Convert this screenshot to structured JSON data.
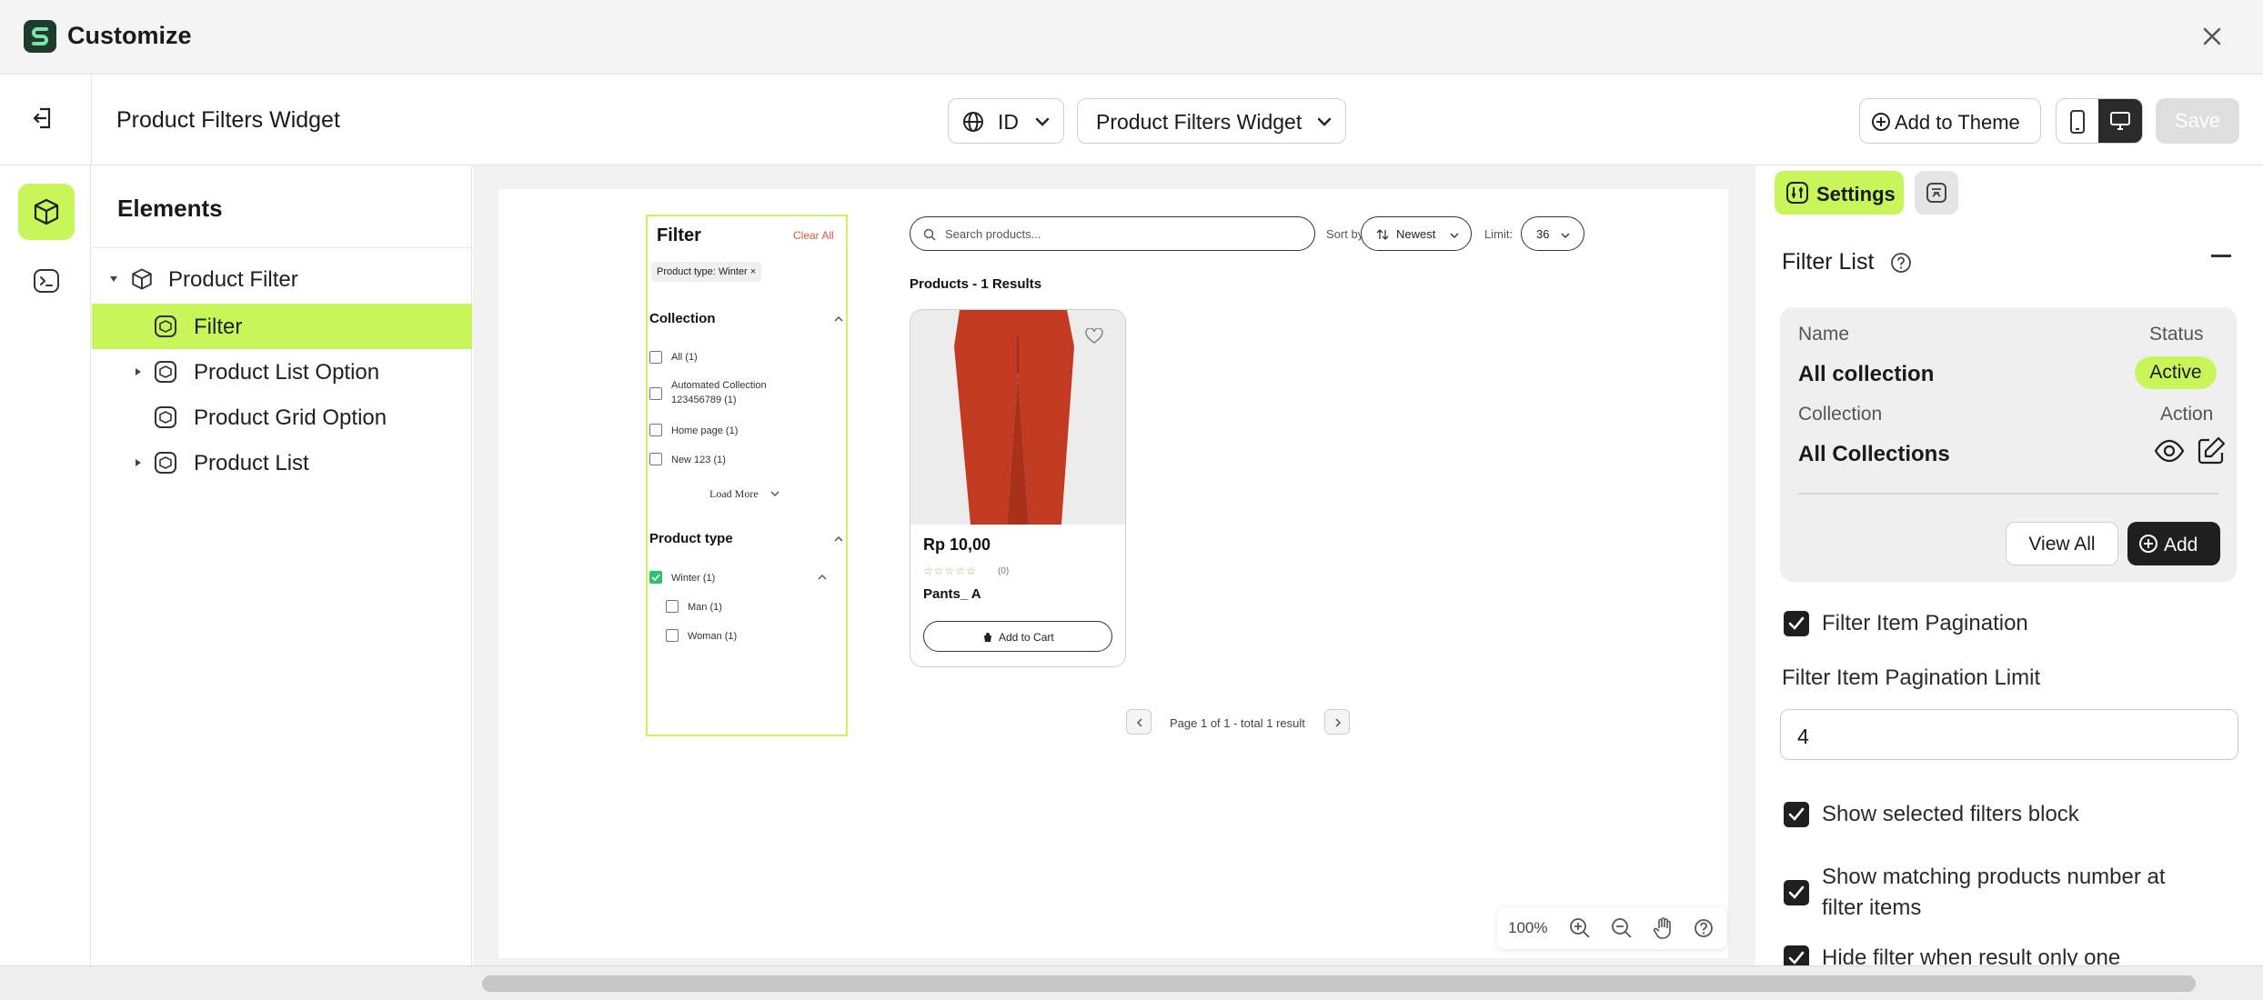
{
  "window": {
    "title": "Customize"
  },
  "header": {
    "page_title": "Product Filters Widget",
    "language": "ID",
    "widget_select": "Product Filters Widget",
    "add_to_theme": "Add to Theme",
    "save": "Save"
  },
  "elements": {
    "title": "Elements",
    "tree": [
      {
        "label": "Product Filter"
      },
      {
        "label": "Filter"
      },
      {
        "label": "Product List Option"
      },
      {
        "label": "Product Grid Option"
      },
      {
        "label": "Product List"
      }
    ]
  },
  "preview": {
    "filter": {
      "title": "Filter",
      "clear_all": "Clear All",
      "chip": "Product type: Winter ×",
      "collection": {
        "title": "Collection",
        "items": [
          "All (1)",
          "Automated Collection",
          "123456789 (1)",
          "Home page (1)",
          "New 123 (1)"
        ],
        "load_more": "Load More"
      },
      "product_type": {
        "title": "Product type",
        "items": [
          "Winter (1)",
          "Man (1)",
          "Woman (1)"
        ]
      }
    },
    "search_placeholder": "Search products...",
    "sort_label": "Sort by:",
    "sort_value": "Newest",
    "limit_label": "Limit:",
    "limit_value": "36",
    "results": "Products - 1 Results",
    "product": {
      "price": "Rp 10,00",
      "stars": "☆☆☆☆☆",
      "reviews": "(0)",
      "name": "Pants_ A",
      "add_to_cart": "Add to Cart"
    },
    "pagination": "Page 1 of 1 - total 1 result",
    "zoom": "100%"
  },
  "settings": {
    "tab": "Settings",
    "section": "Filter List",
    "card": {
      "name_label": "Name",
      "status_label": "Status",
      "name": "All collection",
      "status": "Active",
      "collection_label": "Collection",
      "action_label": "Action",
      "collection": "All Collections",
      "view_all": "View All",
      "add": "Add"
    },
    "pagination_check": "Filter Item Pagination",
    "pagination_limit_label": "Filter Item Pagination Limit",
    "pagination_limit_value": "4",
    "show_selected": "Show selected filters block",
    "show_matching_1": "Show matching products number at",
    "show_matching_2": "filter items",
    "hide_filter": "Hide filter when result only one"
  },
  "colors": {
    "accent": "#c8f55a",
    "dark": "#1f1f1f",
    "danger": "#e0573b",
    "product": "#c23a22"
  }
}
